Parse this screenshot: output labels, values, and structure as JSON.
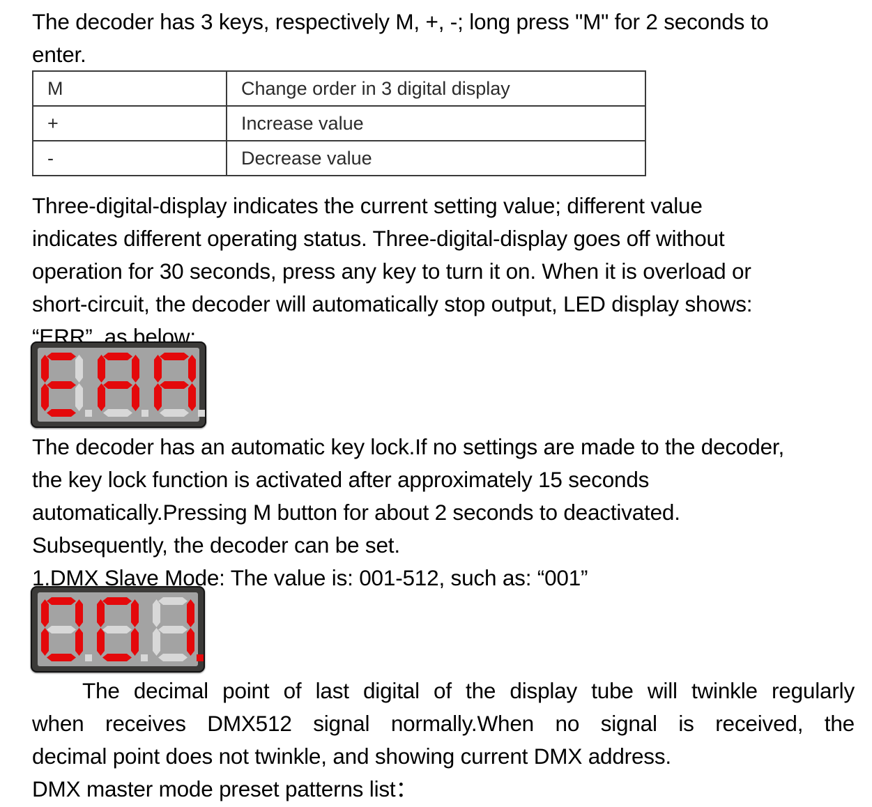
{
  "document": {
    "intro_paragraph": {
      "lines": [
        "The decoder has 3 keys, respectively M, +, -; long press \"M\" for 2 seconds to",
        "enter."
      ]
    },
    "key_table": {
      "rows": [
        {
          "key": "M",
          "action": "Change order in 3 digital display"
        },
        {
          "key": "+",
          "action": "Increase value"
        },
        {
          "key": "-",
          "action": "Decrease value"
        }
      ]
    },
    "status_paragraph": {
      "lines": [
        "Three-digital-display indicates the current setting value; different value",
        "indicates different operating status. Three-digital-display goes off without",
        "operation for 30 seconds, press any key to turn it on. When it is overload or",
        "short-circuit, the decoder will automatically stop output, LED display shows:",
        "“ERR”, as below:"
      ]
    },
    "err_display": {
      "label": "ERR",
      "digits": [
        {
          "char": "E",
          "segments": [
            "a",
            "f",
            "g",
            "e",
            "d"
          ],
          "decimal_point": false
        },
        {
          "char": "R",
          "segments": [
            "a",
            "f",
            "b",
            "g",
            "e",
            "c"
          ],
          "decimal_point": false
        },
        {
          "char": "R",
          "segments": [
            "a",
            "f",
            "b",
            "g",
            "e",
            "c"
          ],
          "decimal_point": false
        }
      ],
      "on_color": "#e4090b",
      "off_color": "#d8d8d8",
      "screen_color": "#a3a3a3",
      "bezel_color": "#3b3a38"
    },
    "keylock_paragraph": {
      "lines": [
        "The decoder has an automatic key lock.If no settings are made to the decoder,",
        "the key lock function is activated after approximately 15 seconds",
        "automatically.Pressing M button for about 2 seconds to deactivated.",
        "Subsequently, the decoder can be set.",
        "1.DMX Slave Mode: The value is: 001-512, such as: “001”"
      ]
    },
    "address_display": {
      "label": "001",
      "digits": [
        {
          "char": "0",
          "segments": [
            "a",
            "f",
            "b",
            "e",
            "c",
            "d"
          ],
          "decimal_point": false
        },
        {
          "char": "0",
          "segments": [
            "a",
            "f",
            "b",
            "e",
            "c",
            "d"
          ],
          "decimal_point": false
        },
        {
          "char": "1",
          "segments": [
            "b",
            "c"
          ],
          "decimal_point": true
        }
      ],
      "on_color": "#e4090b",
      "off_color": "#d8d8d8",
      "screen_color": "#a3a3a3",
      "bezel_color": "#3b3a38"
    },
    "decimal_paragraph": {
      "lines": [
        "The decimal point of last digital of the display tube will twinkle regularly",
        "when receives DMX512 signal normally.When no signal is received, the",
        "decimal point does not twinkle, and showing current DMX address."
      ],
      "indent_first_line": true
    },
    "preset_list_heading": "DMX master mode preset patterns list："
  }
}
